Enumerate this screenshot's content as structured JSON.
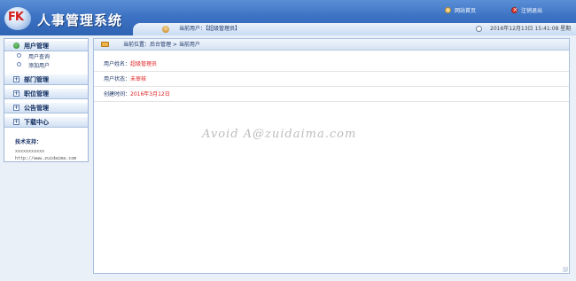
{
  "app": {
    "logo_text": "FK",
    "title": "人事管理系统"
  },
  "header": {
    "home_label": "网站首页",
    "logout_label": "注销退出",
    "current_user_prefix": "当前用户：",
    "current_user_value": "【超级管理员】",
    "datetime": "2016年12月13日 15:41:08 星期二"
  },
  "sidebar": {
    "menus": [
      {
        "label": "用户管理",
        "expanded": true,
        "items": [
          {
            "label": "用户查询"
          },
          {
            "label": "添加用户"
          }
        ]
      },
      {
        "label": "部门管理",
        "expanded": false
      },
      {
        "label": "职位管理",
        "expanded": false
      },
      {
        "label": "公告管理",
        "expanded": false
      },
      {
        "label": "下载中心",
        "expanded": false
      }
    ],
    "support": {
      "label": "技术支持：",
      "line1": "xxxxxxxxxxx",
      "line2": "http://www.zuidaima.com"
    }
  },
  "main": {
    "breadcrumb": "当前位置：后台管理 > 当前用户",
    "rows": [
      {
        "label": "用户姓名：",
        "value": "超级管理员"
      },
      {
        "label": "用户状态：",
        "value": "未审核"
      },
      {
        "label": "创建时间：",
        "value": "2016年3月12日"
      }
    ]
  },
  "watermark": "Avoid A@zuidaima.com",
  "colors": {
    "header_blue": "#3d73c4",
    "value_red": "#e02020",
    "text_navy": "#1a3366"
  }
}
